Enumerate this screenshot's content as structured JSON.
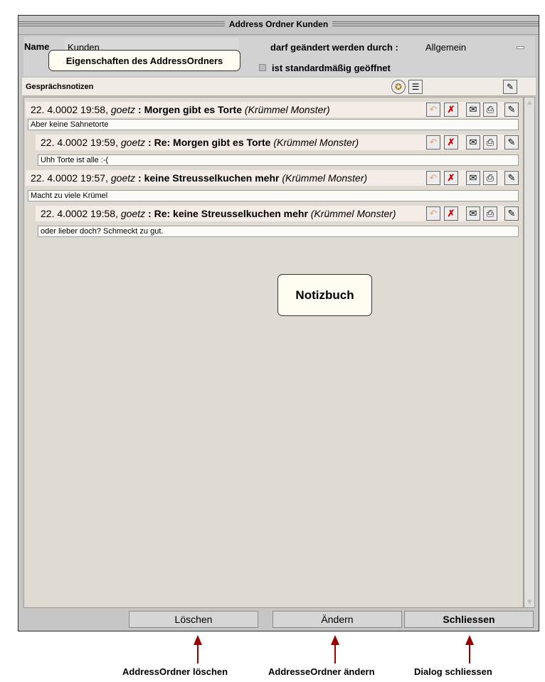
{
  "window": {
    "title": "Address Ordner  Kunden"
  },
  "properties": {
    "name_label": "Name",
    "name_value": "Kunden",
    "permission_label": "darf geändert werden durch :",
    "permission_value": "Allgemein",
    "default_open_label": "ist standardmäßig geöffnet",
    "default_open_checked": false
  },
  "callouts": {
    "properties": "Eigenschaften des AddressOrdners",
    "notebook": "Notizbuch"
  },
  "notes": {
    "header_label": "Gesprächsnotizen",
    "entries": [
      {
        "date": "22. 4.0002 19:58,",
        "user": "goetz",
        "subject": "Morgen gibt es Torte",
        "author": "(Krümmel Monster)",
        "body": "Aber keine Sahnetorte"
      },
      {
        "date": "22. 4.0002 19:59,",
        "user": "goetz",
        "subject": "Re:  Morgen gibt es Torte",
        "author": "(Krümmel Monster)",
        "body": "Uhh Torte ist alle :-("
      },
      {
        "date": "22. 4.0002 19:57,",
        "user": "goetz",
        "subject": "keine Streusselkuchen mehr",
        "author": "(Krümmel Monster)",
        "body": "Macht zu viele Krümel"
      },
      {
        "date": "22. 4.0002 19:58,",
        "user": "goetz",
        "subject": "Re:  keine Streusselkuchen mehr",
        "author": "(Krümmel Monster)",
        "body": "oder lieber doch? Schmeckt zu gut."
      }
    ]
  },
  "buttons": {
    "delete": "Löschen",
    "change": "Ändern",
    "close": "Schliessen"
  },
  "captions": {
    "delete": "AddressOrdner löschen",
    "change": "AddresseOrdner ändern",
    "close": "Dialog schliessen"
  },
  "colors": {
    "arrow": "#9b0000",
    "delete_icon": "#d00000"
  },
  "icons": [
    "reply-icon",
    "delete-icon",
    "mail-icon",
    "print-icon",
    "edit-icon",
    "new-note-icon",
    "list-icon"
  ]
}
